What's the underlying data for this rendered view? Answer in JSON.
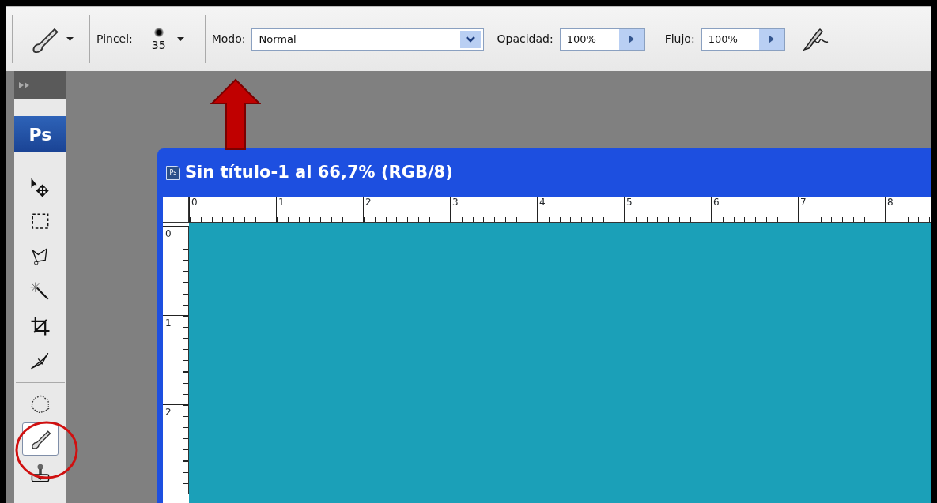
{
  "options_bar": {
    "tool_preset": {
      "kind": "brush"
    },
    "brush": {
      "label": "Pincel:",
      "size": "35"
    },
    "mode": {
      "label": "Modo:",
      "value": "Normal"
    },
    "opacity": {
      "label": "Opacidad:",
      "value": "100%"
    },
    "flow": {
      "label": "Flujo:",
      "value": "100%"
    },
    "airbrush": {
      "on": false
    }
  },
  "toolbox": {
    "logo": "Ps",
    "tool_groups": [
      [
        {
          "kind": "move",
          "selected": false
        },
        {
          "kind": "marquee",
          "selected": false
        },
        {
          "kind": "lasso",
          "selected": false
        },
        {
          "kind": "wand",
          "selected": false
        },
        {
          "kind": "crop",
          "selected": false
        },
        {
          "kind": "slice",
          "selected": false
        }
      ],
      [
        {
          "kind": "heal",
          "selected": false
        },
        {
          "kind": "brush",
          "selected": true
        },
        {
          "kind": "stamp",
          "selected": false
        }
      ]
    ]
  },
  "document": {
    "icon_text": "Ps",
    "title": "Sin título-1 al 66,7% (RGB/8)",
    "horizontal_ruler": [
      "0",
      "1",
      "2",
      "3",
      "4",
      "5",
      "6",
      "7",
      "8"
    ],
    "vertical_ruler": [
      "0",
      "1",
      "2"
    ]
  }
}
